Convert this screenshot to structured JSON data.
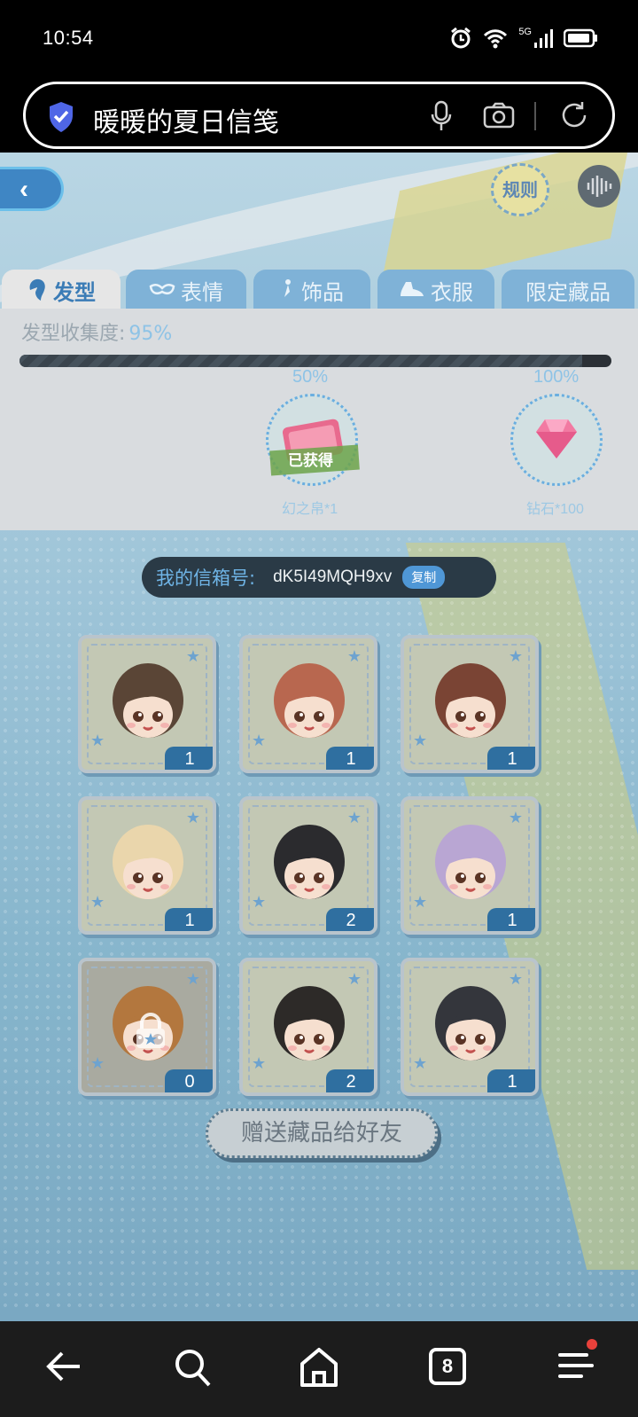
{
  "status": {
    "time": "10:54",
    "network": "5G",
    "icons": [
      "alarm-icon",
      "wifi-icon",
      "signal-icon",
      "battery-icon"
    ]
  },
  "browser": {
    "title": "暖暖的夏日信笺"
  },
  "game": {
    "rules_label": "规则",
    "tabs": [
      {
        "label": "发型",
        "active": true
      },
      {
        "label": "表情",
        "active": false
      },
      {
        "label": "饰品",
        "active": false
      },
      {
        "label": "衣服",
        "active": false
      },
      {
        "label": "限定藏品",
        "active": false
      }
    ],
    "collection": {
      "label": "发型收集度:",
      "value": "95%",
      "progress": 0.95,
      "milestones": [
        {
          "percent": "50%",
          "reward": "幻之帛*1",
          "status": "已获得"
        },
        {
          "percent": "100%",
          "reward": "钻石*100",
          "status": ""
        }
      ]
    },
    "mailbox": {
      "label": "我的信箱号:",
      "code": "dK5I49MQH9xv",
      "copy_label": "复制"
    },
    "items": [
      {
        "count": "1",
        "locked": false,
        "hair": "#5a4536"
      },
      {
        "count": "1",
        "locked": false,
        "hair": "#b8674f"
      },
      {
        "count": "1",
        "locked": false,
        "hair": "#7a4434"
      },
      {
        "count": "1",
        "locked": false,
        "hair": "#ead6ac"
      },
      {
        "count": "2",
        "locked": false,
        "hair": "#2b2b2e"
      },
      {
        "count": "1",
        "locked": false,
        "hair": "#b9a6d3"
      },
      {
        "count": "0",
        "locked": true,
        "hair": "#b3773e"
      },
      {
        "count": "2",
        "locked": false,
        "hair": "#2d2a28"
      },
      {
        "count": "1",
        "locked": false,
        "hair": "#34363c"
      }
    ],
    "gift_button": "赠送藏品给好友"
  },
  "nav": {
    "tabs_count": "8"
  }
}
